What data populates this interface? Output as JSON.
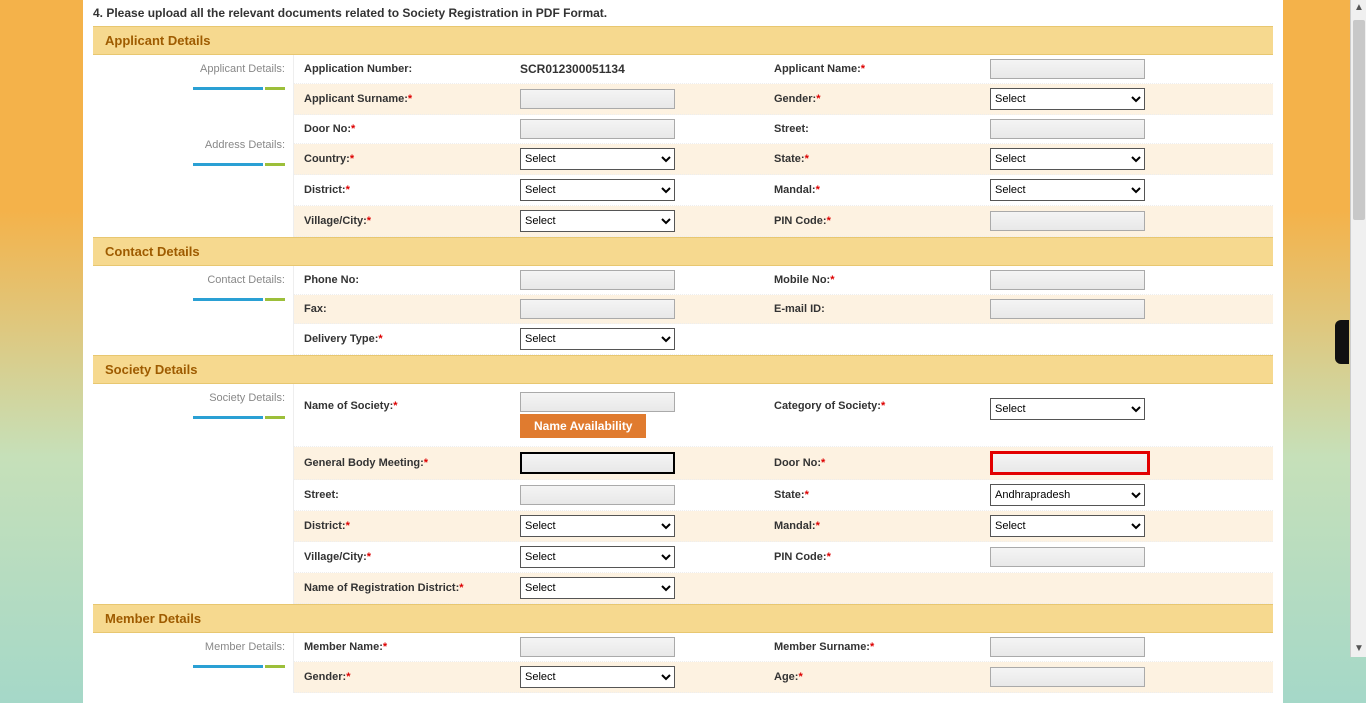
{
  "instruction": "4. Please upload all the relevant documents related to Society Registration in PDF Format.",
  "select_placeholder": "Select",
  "sections": {
    "applicant": {
      "header": "Applicant Details",
      "side_labels": {
        "s1": "Applicant Details:",
        "s2": "Address Details:"
      },
      "labels": {
        "app_no": "Application Number:",
        "app_name": "Applicant Name:",
        "surname": "Applicant Surname:",
        "gender": "Gender:",
        "door": "Door No:",
        "street": "Street:",
        "country": "Country:",
        "state": "State:",
        "district": "District:",
        "mandal": "Mandal:",
        "village": "Village/City:",
        "pin": "PIN Code:"
      },
      "values": {
        "app_no": "SCR012300051134"
      }
    },
    "contact": {
      "header": "Contact Details",
      "side_label": "Contact Details:",
      "labels": {
        "phone": "Phone No:",
        "mobile": "Mobile No:",
        "fax": "Fax:",
        "email": "E-mail ID:",
        "delivery": "Delivery Type:"
      }
    },
    "society": {
      "header": "Society Details",
      "side_label": "Society Details:",
      "labels": {
        "name": "Name of  Society:",
        "category": "Category of Society:",
        "gbm": "General Body Meeting:",
        "door": "Door No:",
        "street": "Street:",
        "state": "State:",
        "district": "District:",
        "mandal": "Mandal:",
        "village": "Village/City:",
        "pin": "PIN Code:",
        "reg_district": "Name of Registration District:"
      },
      "name_availability_btn": "Name Availability",
      "state_value": "Andhrapradesh"
    },
    "member": {
      "header": "Member Details",
      "side_label": "Member Details:",
      "labels": {
        "name": "Member Name:",
        "surname": "Member Surname:",
        "gender": "Gender:",
        "age": "Age:"
      }
    }
  }
}
